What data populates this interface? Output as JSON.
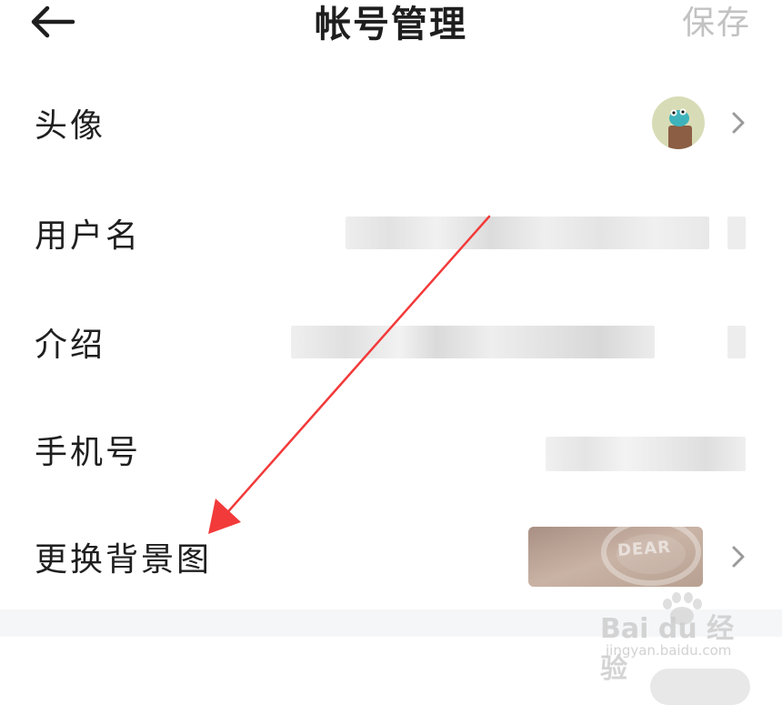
{
  "header": {
    "title": "帐号管理",
    "save_label": "保存",
    "back_icon": "arrow-left-icon"
  },
  "rows": [
    {
      "label": "头像",
      "value_type": "avatar-image"
    },
    {
      "label": "用户名",
      "value_type": "blurred-text"
    },
    {
      "label": "介绍",
      "value_type": "blurred-text"
    },
    {
      "label": "手机号",
      "value_type": "blurred-text"
    },
    {
      "label": "更换背景图",
      "value_type": "background-thumbnail"
    }
  ],
  "background_thumbnail": {
    "overlay_text": "DEAR"
  },
  "watermark": {
    "brand": "Bai du 经验",
    "url": "jingyan.baidu.com"
  },
  "colors": {
    "title_text": "#1e1e1e",
    "save_disabled": "#c2c2c2",
    "chevron": "#9a9a9a",
    "annotation_arrow": "#f23a3a",
    "section_gap": "#f5f6f8"
  }
}
